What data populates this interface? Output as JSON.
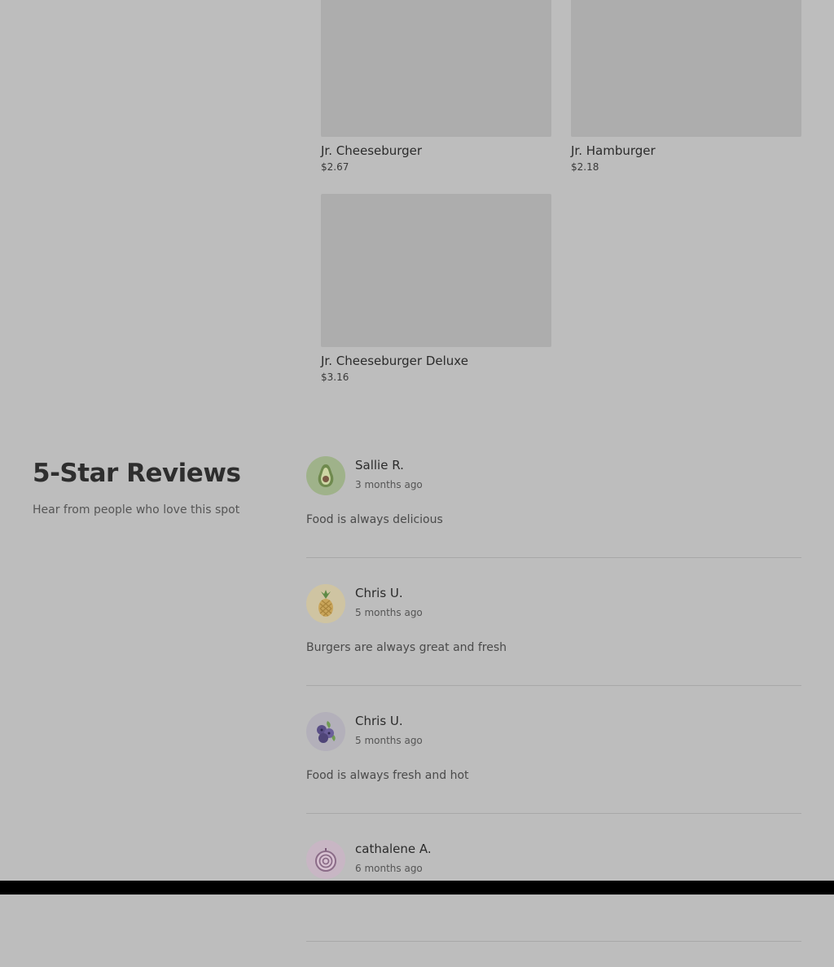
{
  "menu": {
    "items": [
      {
        "name": "Jr. Cheeseburger",
        "price": "$2.67"
      },
      {
        "name": "Jr. Hamburger",
        "price": "$2.18"
      },
      {
        "name": "Jr. Cheeseburger Deluxe",
        "price": "$3.16"
      }
    ]
  },
  "reviews": {
    "title": "5-Star Reviews",
    "subtitle": "Hear from people who love this spot",
    "items": [
      {
        "name": "Sallie R.",
        "date": "3 months ago",
        "text": "Food is always delicious",
        "avatar_icon": "avocado-icon",
        "avatar_bg": "#9fb28a"
      },
      {
        "name": "Chris U.",
        "date": "5 months ago",
        "text": "Burgers are always great and fresh",
        "avatar_icon": "pineapple-icon",
        "avatar_bg": "#cfc4a2"
      },
      {
        "name": "Chris U.",
        "date": "5 months ago",
        "text": "Food is always fresh and hot",
        "avatar_icon": "blueberry-icon",
        "avatar_bg": "#b3b0ba"
      },
      {
        "name": "cathalene A.",
        "date": "6 months ago",
        "text": "",
        "avatar_icon": "onion-icon",
        "avatar_bg": "#c8b6c4"
      }
    ]
  }
}
